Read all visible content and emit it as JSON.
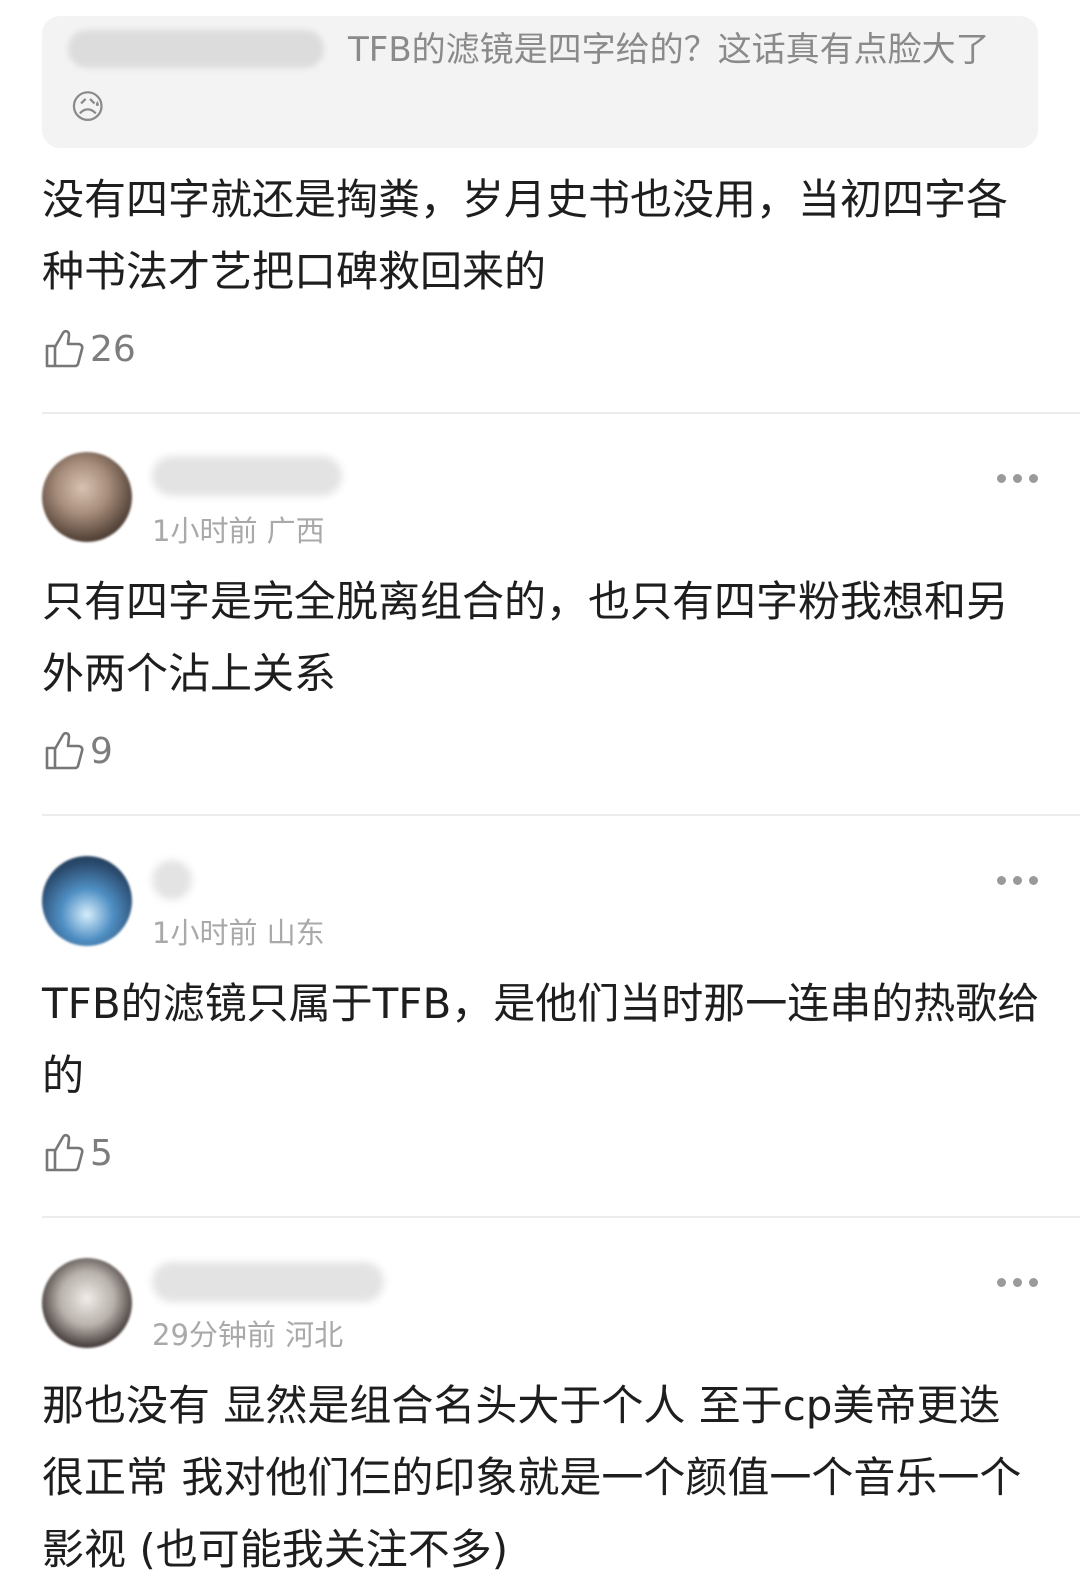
{
  "quote": {
    "text": "TFB的滤镜是四字给的？这话真有点脸大了",
    "emoji": "😥"
  },
  "comments": [
    {
      "text": "没有四字就还是掏粪，岁月史书也没用，当初四字各种书法才艺把口碑救回来的",
      "likes": "26"
    },
    {
      "meta": "1小时前 广西",
      "text": "只有四字是完全脱离组合的，也只有四字粉我想和另外两个沾上关系",
      "likes": "9"
    },
    {
      "meta": "1小时前 山东",
      "text": "TFB的滤镜只属于TFB，是他们当时那一连串的热歌给的",
      "likes": "5"
    },
    {
      "meta": "29分钟前 河北",
      "text": "那也没有 显然是组合名头大于个人 至于cp美帝更迭很正常 我对他们仨的印象就是一个颜值一个音乐一个影视 (也可能我关注不多)"
    }
  ],
  "icons": {
    "like": "thumbs-up-icon",
    "more": "more-dots-icon"
  }
}
